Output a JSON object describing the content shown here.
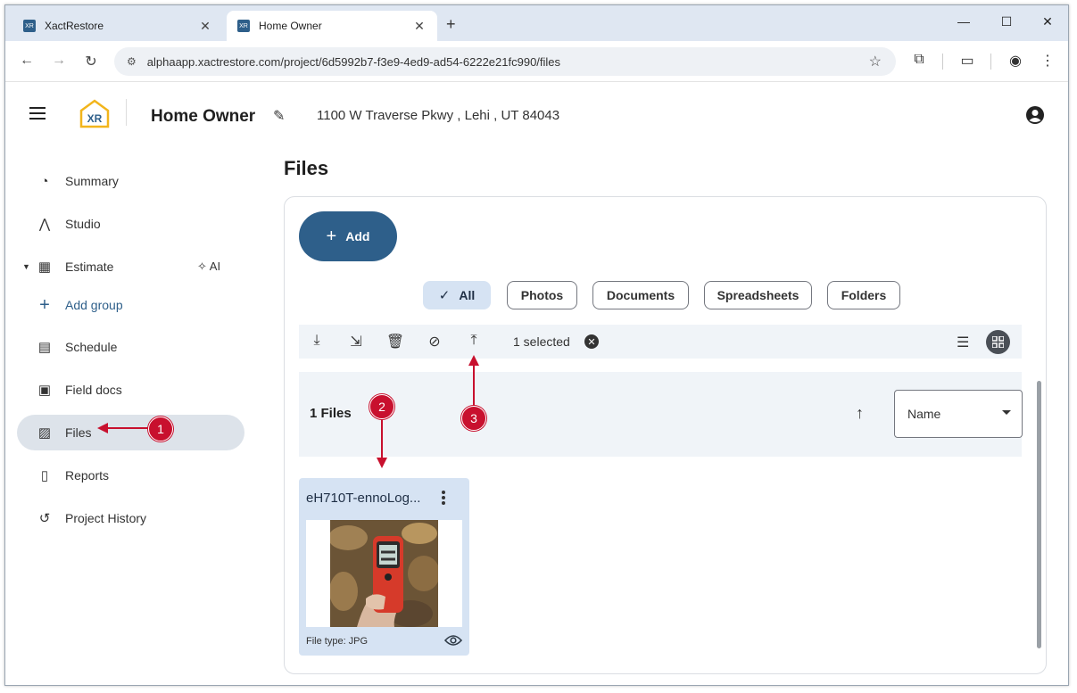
{
  "browser": {
    "tabs": [
      {
        "label": "XactRestore",
        "active": false
      },
      {
        "label": "Home Owner",
        "active": true
      }
    ],
    "url": "alphaapp.xactrestore.com/project/6d5992b7-f3e9-4ed9-ad54-6222e21fc990/files"
  },
  "header": {
    "logo_text": "XR",
    "project_title": "Home Owner",
    "address": "1100 W Traverse Pkwy , Lehi , UT 84043"
  },
  "sidebar": {
    "items": [
      {
        "label": "Summary",
        "icon": "gauge-icon"
      },
      {
        "label": "Studio",
        "icon": "compass-icon"
      },
      {
        "label": "Estimate",
        "icon": "calculator-icon",
        "extra": "AI"
      },
      {
        "label": "Add group",
        "icon": "plus-icon"
      },
      {
        "label": "Schedule",
        "icon": "calendar-icon"
      },
      {
        "label": "Field docs",
        "icon": "clipboard-icon"
      },
      {
        "label": "Files",
        "icon": "image-folder-icon",
        "selected": true
      },
      {
        "label": "Reports",
        "icon": "document-icon"
      },
      {
        "label": "Project History",
        "icon": "history-icon"
      }
    ]
  },
  "main": {
    "title": "Files",
    "add_label": "Add",
    "filters": [
      "All",
      "Photos",
      "Documents",
      "Spreadsheets",
      "Folders"
    ],
    "selected_filter": "All",
    "selection_text": "1 selected",
    "files_count": "1 Files",
    "sort_by": "Name",
    "file": {
      "name": "eH710T-ennoLog...",
      "type_label": "File type: JPG"
    }
  },
  "annotations": [
    "1",
    "2",
    "3"
  ],
  "colors": {
    "accent": "#2e5f8a",
    "chip_selected": "#d6e3f3",
    "callout": "#c8102e"
  }
}
